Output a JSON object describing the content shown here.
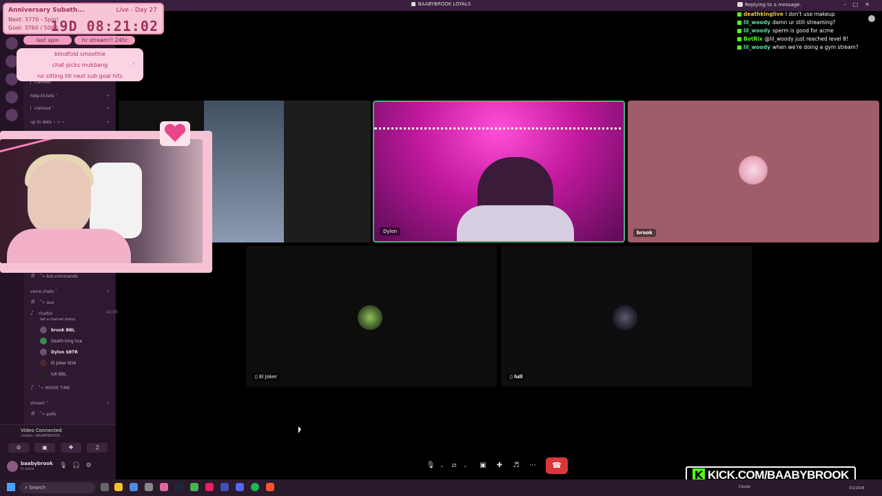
{
  "window": {
    "title": "BAABYBROOK LOYALS"
  },
  "countdown": {
    "title": "Anniversary Subath...",
    "next": "Next: 3770 - Spin!",
    "goal": "Goal: 3760 / 5000",
    "live": "Live - Day 27",
    "timer": "19D 08:21:02"
  },
  "pills": {
    "last": "last spin",
    "hr": "hr stream!! 24hr"
  },
  "rules": [
    "blindfold smoothie",
    "chat picks mukbang",
    "no sitting till next sub goal hits"
  ],
  "sidebar": {
    "channels": [
      {
        "label": "⎸claimed"
      },
      {
        "label": "help-tickets ˅"
      },
      {
        "label": "⎸claimed ˅"
      },
      {
        "label": "up to date ⋆ ☆ ⋆"
      },
      {
        "label": "˚✧-bot-commands"
      },
      {
        "label": "voice chats ˅"
      },
      {
        "label": "˚✧ aux"
      },
      {
        "label": "chattin"
      },
      {
        "label": "˚✧ MOVIE TIME"
      },
      {
        "label": "stream ˅"
      },
      {
        "label": "˚✧-polls"
      }
    ],
    "channel_status": "Set a channel status",
    "voice_timer": "42:05",
    "voice_users": [
      {
        "name": "brook",
        "tag": "BBL"
      },
      {
        "name": "Death king live",
        "tag": ""
      },
      {
        "name": "Dylon",
        "tag": "$BTR"
      },
      {
        "name": "El Joker",
        "tag": "KOA"
      },
      {
        "name": "lull",
        "tag": "BBL"
      }
    ]
  },
  "voice_panel": {
    "title": "Video Connected",
    "subtitle": "chattin / BAABYBROOK ...",
    "user": "baabybrook",
    "status": "In voice"
  },
  "tiles": {
    "dylon": "Dylon",
    "brook": "brook",
    "joker": "El Joker",
    "lull": "lull"
  },
  "chat": {
    "reply_hint": "Replying to a message.",
    "messages": [
      {
        "user": "deathkinglive",
        "text": "I don't use makeup",
        "color": "#f5c542"
      },
      {
        "user": "lil_woody",
        "text": "damn ur still streaming?",
        "color": "#5ee0a0"
      },
      {
        "user": "lil_woody",
        "text": "sperm is good for acme",
        "color": "#5ee0a0"
      },
      {
        "user": "BotRix",
        "text": "@lil_woody just reached level 8!",
        "color": "#53fc18"
      },
      {
        "user": "lil_woody",
        "text": "when we're doing a gym stream?",
        "color": "#5ee0a0"
      }
    ]
  },
  "watermark": {
    "text": "KICK.COM/BAABYBROOK"
  },
  "taskbar": {
    "search": "Search",
    "weather": "Cloudy",
    "date": "3/1/2026"
  },
  "colors": {
    "accent": "#f28cb1",
    "kick": "#53fc18",
    "end_call": "#da373c",
    "speaking": "#43b581"
  }
}
